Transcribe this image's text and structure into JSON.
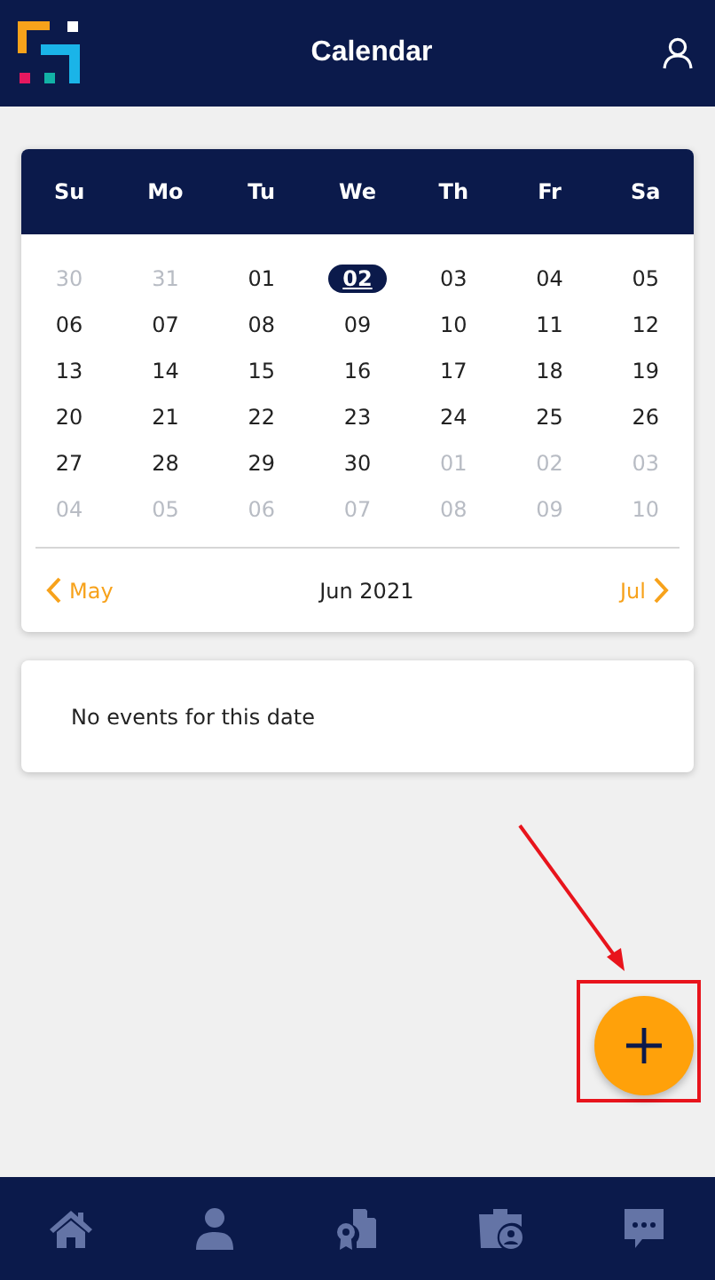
{
  "header": {
    "title": "Calendar"
  },
  "calendar": {
    "weekdays": [
      "Su",
      "Mo",
      "Tu",
      "We",
      "Th",
      "Fr",
      "Sa"
    ],
    "weeks": [
      [
        {
          "label": "30",
          "outside": true,
          "selected": false
        },
        {
          "label": "31",
          "outside": true,
          "selected": false
        },
        {
          "label": "01",
          "outside": false,
          "selected": false
        },
        {
          "label": "02",
          "outside": false,
          "selected": true
        },
        {
          "label": "03",
          "outside": false,
          "selected": false
        },
        {
          "label": "04",
          "outside": false,
          "selected": false
        },
        {
          "label": "05",
          "outside": false,
          "selected": false
        }
      ],
      [
        {
          "label": "06",
          "outside": false,
          "selected": false
        },
        {
          "label": "07",
          "outside": false,
          "selected": false
        },
        {
          "label": "08",
          "outside": false,
          "selected": false
        },
        {
          "label": "09",
          "outside": false,
          "selected": false
        },
        {
          "label": "10",
          "outside": false,
          "selected": false
        },
        {
          "label": "11",
          "outside": false,
          "selected": false
        },
        {
          "label": "12",
          "outside": false,
          "selected": false
        }
      ],
      [
        {
          "label": "13",
          "outside": false,
          "selected": false
        },
        {
          "label": "14",
          "outside": false,
          "selected": false
        },
        {
          "label": "15",
          "outside": false,
          "selected": false
        },
        {
          "label": "16",
          "outside": false,
          "selected": false
        },
        {
          "label": "17",
          "outside": false,
          "selected": false
        },
        {
          "label": "18",
          "outside": false,
          "selected": false
        },
        {
          "label": "19",
          "outside": false,
          "selected": false
        }
      ],
      [
        {
          "label": "20",
          "outside": false,
          "selected": false
        },
        {
          "label": "21",
          "outside": false,
          "selected": false
        },
        {
          "label": "22",
          "outside": false,
          "selected": false
        },
        {
          "label": "23",
          "outside": false,
          "selected": false
        },
        {
          "label": "24",
          "outside": false,
          "selected": false
        },
        {
          "label": "25",
          "outside": false,
          "selected": false
        },
        {
          "label": "26",
          "outside": false,
          "selected": false
        }
      ],
      [
        {
          "label": "27",
          "outside": false,
          "selected": false
        },
        {
          "label": "28",
          "outside": false,
          "selected": false
        },
        {
          "label": "29",
          "outside": false,
          "selected": false
        },
        {
          "label": "30",
          "outside": false,
          "selected": false
        },
        {
          "label": "01",
          "outside": true,
          "selected": false
        },
        {
          "label": "02",
          "outside": true,
          "selected": false
        },
        {
          "label": "03",
          "outside": true,
          "selected": false
        }
      ],
      [
        {
          "label": "04",
          "outside": true,
          "selected": false
        },
        {
          "label": "05",
          "outside": true,
          "selected": false
        },
        {
          "label": "06",
          "outside": true,
          "selected": false
        },
        {
          "label": "07",
          "outside": true,
          "selected": false
        },
        {
          "label": "08",
          "outside": true,
          "selected": false
        },
        {
          "label": "09",
          "outside": true,
          "selected": false
        },
        {
          "label": "10",
          "outside": true,
          "selected": false
        }
      ]
    ],
    "prev": "May",
    "current": "Jun 2021",
    "next": "Jul"
  },
  "events": {
    "message": "No events for this date"
  }
}
